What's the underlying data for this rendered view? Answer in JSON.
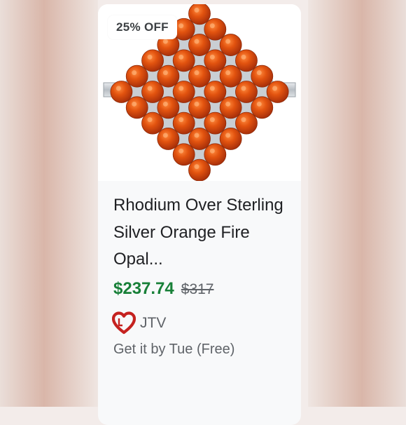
{
  "product_card": {
    "badge": "25% OFF",
    "title": "Rhodium Over Sterling Silver Orange Fire Opal...",
    "price": "$237.74",
    "original_price": "$317",
    "seller": {
      "name": "JTV",
      "logo_icon": "heart-logo-icon"
    },
    "delivery": "Get it by Tue (Free)",
    "image_icon": "orange-opal-ring-image"
  },
  "colors": {
    "price": "#188038",
    "badge_text": "#3c4043",
    "title": "#202124",
    "muted": "#5f6368",
    "gem": "#d9480f",
    "seller_logo": "#c5221f"
  }
}
